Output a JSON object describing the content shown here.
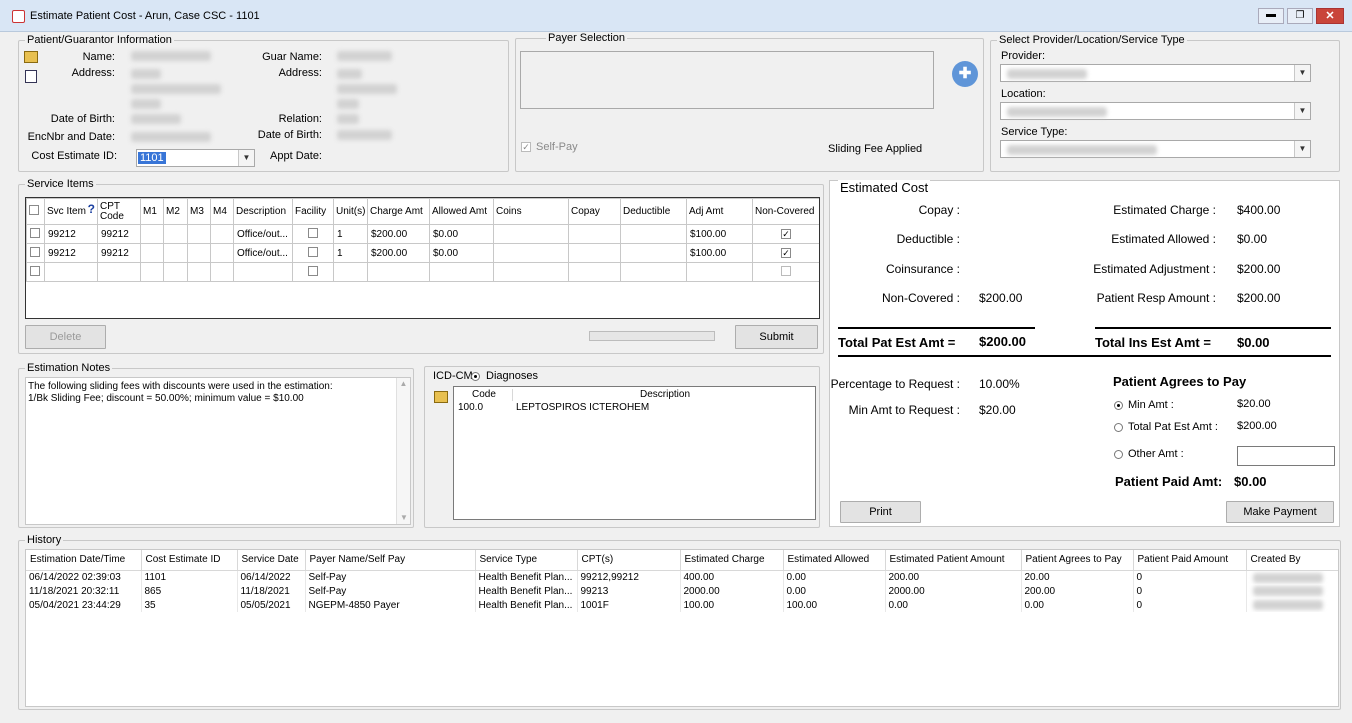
{
  "window": {
    "title": "Estimate Patient Cost - Arun, Case CSC - 1101"
  },
  "patient": {
    "group_title": "Patient/Guarantor Information",
    "name_label": "Name:",
    "address_label": "Address:",
    "dob_label": "Date of Birth:",
    "enc_label": "EncNbr and Date:",
    "cost_id_label": "Cost Estimate ID:",
    "cost_id_value": "1101",
    "guar_name_label": "Guar Name:",
    "guar_address_label": "Address:",
    "relation_label": "Relation:",
    "guar_dob_label": "Date of Birth:",
    "appt_label": "Appt Date:"
  },
  "payer": {
    "group_title": "Payer Selection",
    "self_pay_label": "Self-Pay",
    "self_pay_checked": "✓",
    "sliding_fee": "Sliding Fee Applied"
  },
  "provider": {
    "group_title": "Select Provider/Location/Service Type",
    "provider_label": "Provider:",
    "location_label": "Location:",
    "service_label": "Service Type:"
  },
  "service_items": {
    "group_title": "Service Items",
    "headers": [
      "Svc Item",
      "CPT Code",
      "M1",
      "M2",
      "M3",
      "M4",
      "Description",
      "Facility",
      "Unit(s)",
      "Charge Amt",
      "Allowed Amt",
      "Coins",
      "Copay",
      "Deductible",
      "Adj Amt",
      "Non-Covered"
    ],
    "rows": [
      [
        "99212",
        "99212",
        "",
        "",
        "",
        "",
        "Office/out...",
        "",
        "1",
        "$200.00",
        "$0.00",
        "",
        "",
        "",
        "$100.00",
        "✓"
      ],
      [
        "99212",
        "99212",
        "",
        "",
        "",
        "",
        "Office/out...",
        "",
        "1",
        "$200.00",
        "$0.00",
        "",
        "",
        "",
        "$100.00",
        "✓"
      ]
    ],
    "delete_label": "Delete",
    "submit_label": "Submit",
    "help_glyph": "?"
  },
  "estimated": {
    "group_title": "Estimated Cost",
    "copay_label": "Copay :",
    "deductible_label": "Deductible :",
    "coins_label": "Coinsurance :",
    "noncovered_label": "Non-Covered :",
    "noncovered_value": "$200.00",
    "est_charge_label": "Estimated Charge :",
    "est_charge_value": "$400.00",
    "est_allowed_label": "Estimated Allowed :",
    "est_allowed_value": "$0.00",
    "est_adj_label": "Estimated Adjustment :",
    "est_adj_value": "$200.00",
    "resp_label": "Patient Resp Amount :",
    "resp_value": "$200.00",
    "total_pat_label": "Total Pat Est Amt =",
    "total_pat_value": "$200.00",
    "total_ins_label": "Total Ins Est Amt =",
    "total_ins_value": "$0.00",
    "pct_label": "Percentage to Request :",
    "pct_value": "10.00%",
    "min_label": "Min Amt to Request :",
    "min_value": "$20.00",
    "agrees_title": "Patient Agrees to Pay",
    "opt_min_label": "Min Amt :",
    "opt_min_value": "$20.00",
    "opt_total_label": "Total Pat Est Amt :",
    "opt_total_value": "$200.00",
    "opt_other_label": "Other Amt :",
    "paid_label": "Patient Paid Amt:",
    "paid_value": "$0.00",
    "print_label": "Print",
    "make_payment_label": "Make Payment"
  },
  "notes": {
    "group_title": "Estimation Notes",
    "line1": "The following sliding fees with discounts were used in the estimation:",
    "line2": "1/Bk Sliding Fee; discount =  50.00%; minimum value =  $10.00"
  },
  "icd": {
    "label": "ICD-CM",
    "diag_label": "Diagnoses",
    "code_header": "Code",
    "desc_header": "Description",
    "code": "100.0",
    "desc": "LEPTOSPIROS ICTEROHEM"
  },
  "history": {
    "group_title": "History",
    "headers": [
      "Estimation Date/Time",
      "Cost Estimate ID",
      "Service Date",
      "Payer Name/Self Pay",
      "Service Type",
      "CPT(s)",
      "Estimated Charge",
      "Estimated Allowed",
      "Estimated Patient Amount",
      "Patient Agrees to Pay",
      "Patient Paid Amount",
      "Created By"
    ],
    "rows": [
      [
        "06/14/2022 02:39:03",
        "1101",
        "06/14/2022",
        "Self-Pay",
        "Health  Benefit  Plan...",
        "99212,99212",
        "400.00",
        "0.00",
        "200.00",
        "20.00",
        "0",
        ""
      ],
      [
        "11/18/2021 20:32:11",
        "865",
        "11/18/2021",
        "Self-Pay",
        "Health  Benefit  Plan...",
        "99213",
        "2000.00",
        "0.00",
        "2000.00",
        "200.00",
        "0",
        ""
      ],
      [
        "05/04/2021 23:44:29",
        "35",
        "05/05/2021",
        "NGEPM-4850 Payer",
        "Health  Benefit  Plan...",
        "1001F",
        "100.00",
        "100.00",
        "0.00",
        "0.00",
        "0",
        ""
      ]
    ]
  }
}
